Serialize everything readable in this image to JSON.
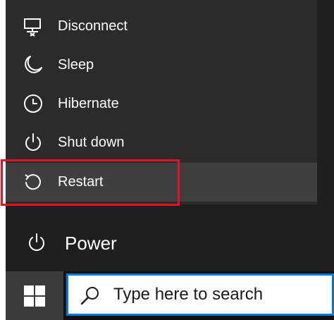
{
  "power_menu": {
    "items": [
      {
        "label": "Disconnect",
        "icon": "disconnect-icon"
      },
      {
        "label": "Sleep",
        "icon": "moon-icon"
      },
      {
        "label": "Hibernate",
        "icon": "clock-icon"
      },
      {
        "label": "Shut down",
        "icon": "power-icon"
      },
      {
        "label": "Restart",
        "icon": "restart-icon",
        "highlighted": true
      }
    ]
  },
  "start": {
    "power_label": "Power",
    "power_icon": "power-icon"
  },
  "taskbar": {
    "start_icon": "windows-logo-icon",
    "search_icon": "search-icon",
    "search_placeholder": "Type here to search"
  },
  "colors": {
    "highlight_border": "#e81123",
    "search_border": "#0078d7",
    "menu_background": "#2b2b2b",
    "panel_background": "#1f1f1f"
  }
}
